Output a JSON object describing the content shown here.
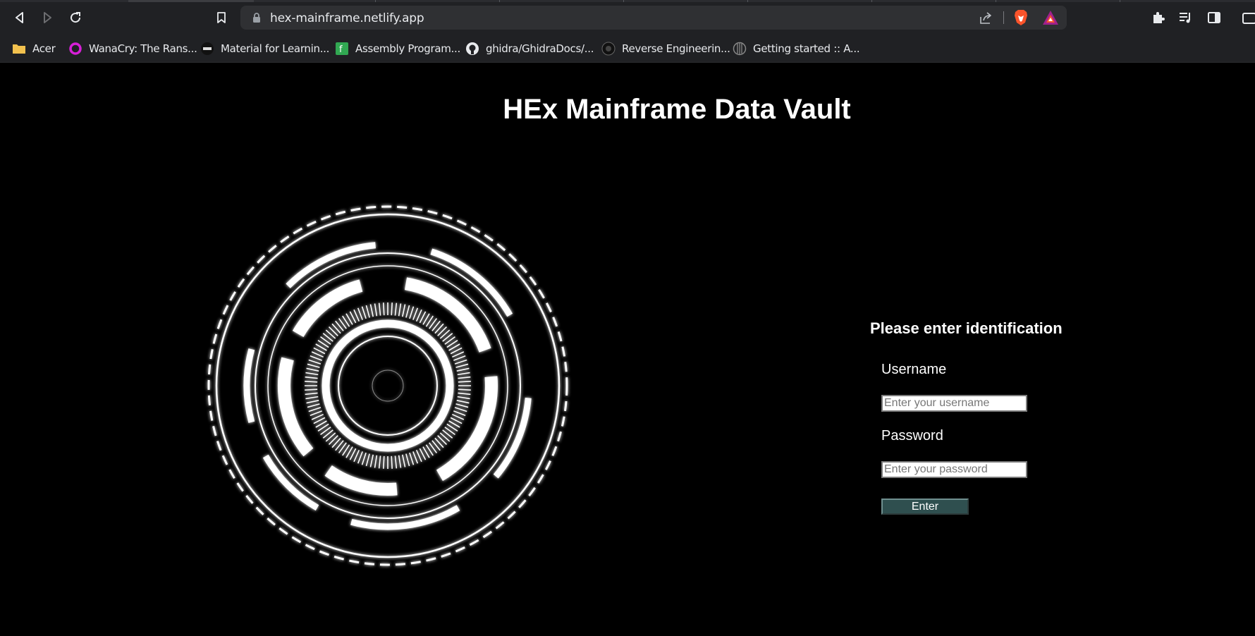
{
  "browser": {
    "url": "hex-mainframe.netlify.app",
    "icons": {
      "back": "back-arrow-icon",
      "forward": "forward-arrow-icon",
      "reload": "reload-icon",
      "bookmark": "bookmark-icon",
      "lock": "lock-icon",
      "share": "share-icon",
      "brave": "brave-shields-icon",
      "rewards": "brave-rewards-icon",
      "extensions": "puzzle-icon",
      "media": "media-queue-icon",
      "sidebar": "sidebar-icon",
      "wallet": "wallet-icon"
    },
    "bookmarks": [
      {
        "label": "Acer",
        "icon": "folder-icon"
      },
      {
        "label": "WanaCry: The Rans...",
        "icon": "ring-favicon"
      },
      {
        "label": "Material for Learnin...",
        "icon": "site-favicon"
      },
      {
        "label": "Assembly Program...",
        "icon": "site-favicon"
      },
      {
        "label": "ghidra/GhidraDocs/...",
        "icon": "github-icon"
      },
      {
        "label": "Reverse Engineerin...",
        "icon": "site-favicon"
      },
      {
        "label": "Getting started :: A...",
        "icon": "site-favicon"
      }
    ]
  },
  "page": {
    "title": "HEx Mainframe Data Vault",
    "hud_icon": "hud-circle-graphic",
    "login": {
      "heading": "Please enter identification",
      "username_label": "Username",
      "username_placeholder": "Enter your username",
      "username_value": "",
      "password_label": "Password",
      "password_placeholder": "Enter your password",
      "password_value": "",
      "submit_label": "Enter"
    }
  },
  "colors": {
    "background": "#000000",
    "chrome": "#202124",
    "omnibox": "#2f3033",
    "button": "#2f4f4f",
    "text": "#ffffff"
  }
}
